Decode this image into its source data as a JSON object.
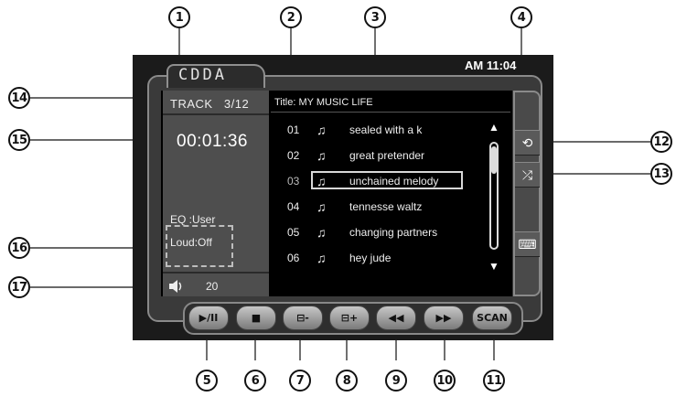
{
  "screen": {
    "source": "CDDA",
    "clock": "AM 11:04",
    "track_label": "TRACK",
    "track_value": "3/12",
    "elapsed": "00:01:36",
    "title": "Title: MY  MUSIC LIFE",
    "eq": "EQ    :User",
    "loud": "Loud:Off",
    "volume": "20",
    "playlist": [
      {
        "num": "01",
        "name": "sealed with a k"
      },
      {
        "num": "02",
        "name": "great pretender"
      },
      {
        "num": "03",
        "name": "unchained melody"
      },
      {
        "num": "04",
        "name": "tennesse waltz"
      },
      {
        "num": "05",
        "name": "changing partners"
      },
      {
        "num": "06",
        "name": "hey jude"
      }
    ],
    "selected_index": 2,
    "note_glyph": "♫",
    "scroll_up": "▲",
    "scroll_down": "▼",
    "side_buttons": [
      "⟲",
      "⤮",
      "⌨"
    ],
    "transport": [
      "▶/II",
      "■",
      "⊟-",
      "⊟+",
      "◀◀",
      "▶▶",
      "SCAN"
    ]
  },
  "callouts": {
    "n1": "1",
    "n2": "2",
    "n3": "3",
    "n4": "4",
    "n5": "5",
    "n6": "6",
    "n7": "7",
    "n8": "8",
    "n9": "9",
    "n10": "10",
    "n11": "11",
    "n12": "12",
    "n13": "13",
    "n14": "14",
    "n15": "15",
    "n16": "16",
    "n17": "17"
  },
  "colors": {
    "screen_bg": "#000000",
    "panel": "#4e4e4e",
    "device": "#1b1b1b",
    "text": "#eeeeee"
  }
}
